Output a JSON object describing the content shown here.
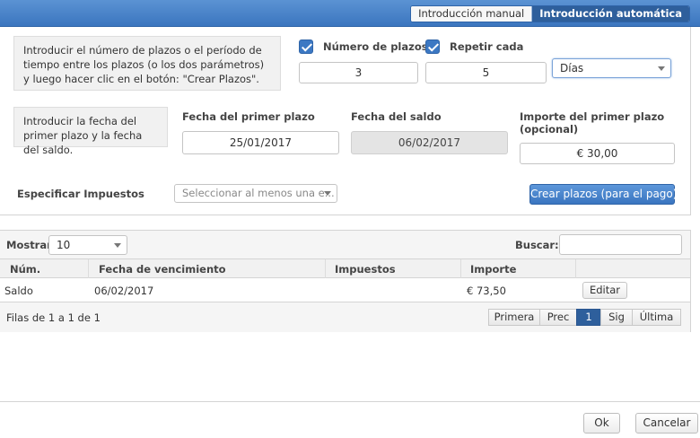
{
  "mode_toggle": {
    "manual": "Introducción manual",
    "automatic": "Introducción automática"
  },
  "plazos_section": {
    "info": "Introducir el número de plazos o el período de tiempo entre los plazos (o los dos parámetros) y luego hacer clic en el botón: \"Crear Plazos\".",
    "num_plazos_label": "Número de plazos",
    "num_plazos_value": "3",
    "repetir_label": "Repetir cada",
    "repetir_value": "5",
    "unit_selected": "Días"
  },
  "fechas_section": {
    "info": "Introducir la fecha del primer plazo y la fecha del saldo.",
    "primer_plazo_label": "Fecha del primer plazo",
    "primer_plazo_value": "25/01/2017",
    "saldo_label": "Fecha del saldo",
    "saldo_value": "06/02/2017",
    "importe_label_1": "Importe del primer plazo",
    "importe_label_2": "(opcional)",
    "importe_value": "€ 30,00"
  },
  "impuestos": {
    "label": "Especificar Impuestos",
    "placeholder": "Seleccionar al menos una e..."
  },
  "crear_button": "Crear plazos (para el pago)",
  "grid": {
    "show_label": "Mostrar",
    "show_value": "10",
    "search_label": "Buscar:",
    "search_value": "",
    "columns": [
      "Núm.",
      "Fecha de vencimiento",
      "Impuestos",
      "Importe"
    ],
    "rows": [
      {
        "num": "Saldo",
        "fecha": "06/02/2017",
        "impuestos": "",
        "importe": "€ 73,50",
        "action": "Editar"
      }
    ],
    "footer_info": "Filas de 1 a 1 de 1",
    "pager": {
      "first": "Primera",
      "prev": "Prec",
      "page": "1",
      "next": "Sig",
      "last": "Última"
    }
  },
  "dialog_buttons": {
    "ok": "Ok",
    "cancel": "Cancelar"
  },
  "colors": {
    "accent": "#3c78c3",
    "accent_dark": "#2e5f9c"
  }
}
